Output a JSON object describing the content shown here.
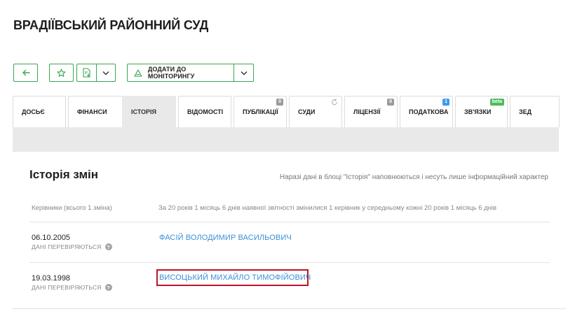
{
  "page": {
    "title": "ВРАДІЇВСЬКИЙ РАЙОННИЙ СУД"
  },
  "toolbar": {
    "monitor_label": "ДОДАТИ ДО МОНІТОРИНГУ",
    "accent_color": "#3aa651"
  },
  "tabs": [
    {
      "label": "ДОСЬЄ"
    },
    {
      "label": "ФІНАНСИ"
    },
    {
      "label": "ІСТОРІЯ",
      "active": true
    },
    {
      "label": "ВІДОМОСТІ"
    },
    {
      "label": "ПУБЛІКАЦІЇ",
      "badge": "0"
    },
    {
      "label": "СУДИ",
      "icon": "refresh-icon"
    },
    {
      "label": "ЛІЦЕНЗІЇ",
      "badge": "0"
    },
    {
      "label": "ПОДАТКОВА",
      "badge": "1"
    },
    {
      "label": "ЗВ'ЯЗКИ",
      "badge": "beta"
    },
    {
      "label": "ЗЕД"
    }
  ],
  "history": {
    "title": "Історія змін",
    "note": "Наразі дані в блоці \"Історія\" наповнюються і несуть лише інформаційний характер",
    "column_left": "Керівники (всього 1 зміна)",
    "column_right": "За 20 років 1 місяць 6 днів наявної звітності змінилися 1 керівник у середньому кожні 20 років 1 місяць 6 днів",
    "rows": [
      {
        "date": "06.10.2005",
        "status": "ДАНІ ПЕРЕВІРЯЮТЬСЯ",
        "name": "ФАСІЙ ВОЛОДИМИР ВАСИЛЬОВИЧ"
      },
      {
        "date": "19.03.1998",
        "status": "ДАНІ ПЕРЕВІРЯЮТЬСЯ",
        "name": "ВИСОЦЬКИЙ МИХАЙЛО ТИМОФІЙОВИЧ"
      }
    ],
    "link_color": "#3a8fd6",
    "highlight_color": "#c0142a"
  }
}
